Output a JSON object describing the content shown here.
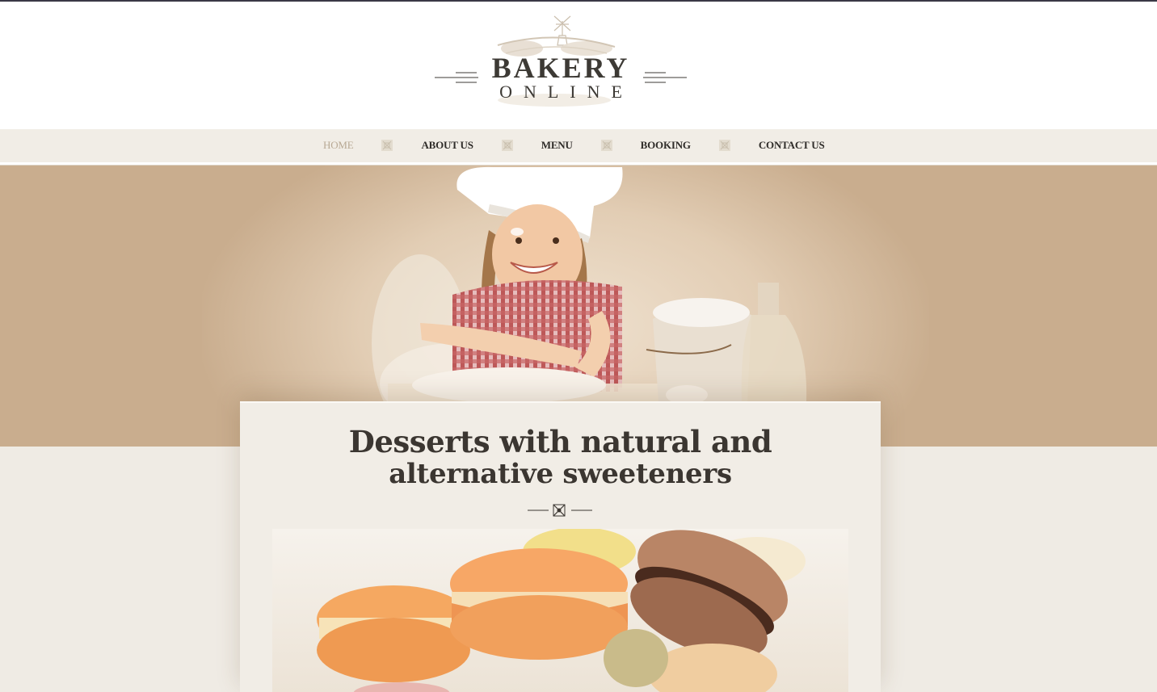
{
  "brand": {
    "title": "BAKERY",
    "subtitle": "ONLINE"
  },
  "nav": {
    "items": [
      {
        "label": "HOME",
        "active": true
      },
      {
        "label": "ABOUT US",
        "active": false
      },
      {
        "label": "MENU",
        "active": false
      },
      {
        "label": "BOOKING",
        "active": false
      },
      {
        "label": "CONTACT US",
        "active": false
      }
    ]
  },
  "hero": {
    "image": "girl-baker-photo"
  },
  "feature": {
    "title": "Desserts with natural and",
    "subtitle": "alternative sweeteners",
    "image": "macarons-photo"
  },
  "colors": {
    "hero_bg": "#c9ad8e",
    "text_dark": "#3b3631",
    "nav_active": "#b8a994",
    "page_bg": "#efebe4"
  }
}
